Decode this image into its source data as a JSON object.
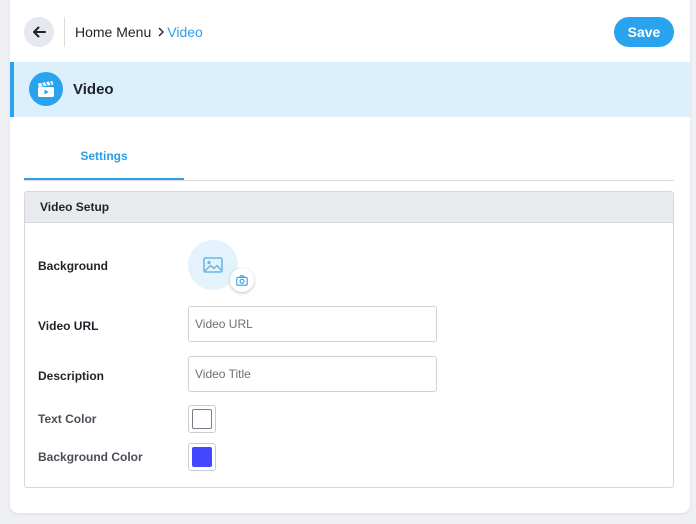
{
  "breadcrumb": {
    "home": "Home Menu",
    "current": "Video"
  },
  "toolbar": {
    "save_label": "Save"
  },
  "section": {
    "title": "Video",
    "icon": "video-clapper-icon"
  },
  "tabs": [
    {
      "label": "Settings",
      "active": true
    }
  ],
  "panel": {
    "title": "Video Setup",
    "background": {
      "label": "Background",
      "icon": "image-icon",
      "upload_icon": "camera-icon"
    },
    "video_url": {
      "label": "Video URL",
      "placeholder": "Video URL",
      "value": ""
    },
    "description": {
      "label": "Description",
      "placeholder": "Video Title",
      "value": ""
    },
    "text_color": {
      "label": "Text Color",
      "value": "#ffffff"
    },
    "background_color": {
      "label": "Background Color",
      "value": "#4547ff"
    }
  },
  "colors": {
    "accent": "#2aa3ee",
    "header_bg": "#dcf0fb",
    "panel_header_bg": "#e8eaed"
  }
}
